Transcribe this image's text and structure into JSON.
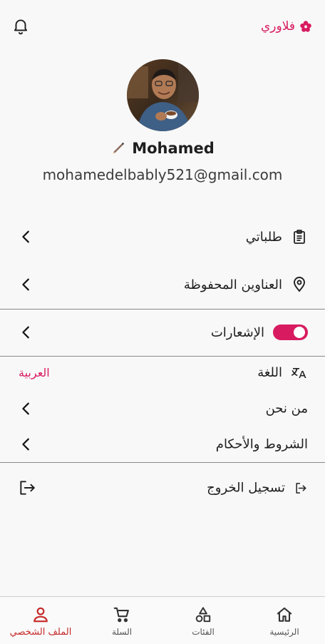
{
  "header": {
    "brand_name": "فلاوري",
    "brand_color": "#d81b60",
    "brand_icon": "flower-icon",
    "notification_icon": "bell-icon"
  },
  "profile": {
    "name": "Mohamed",
    "email": "mohamedelbably521@gmail.com",
    "edit_icon": "pencil-icon",
    "avatar": "profile-photo"
  },
  "menu": {
    "orders": {
      "label": "طلباتي",
      "icon": "clipboard-icon"
    },
    "addresses": {
      "label": "العناوين المحفوظة",
      "icon": "location-pin-icon"
    },
    "notifications": {
      "label": "الإشعارات",
      "enabled": true
    },
    "language": {
      "label": "اللغة",
      "value": "العربية",
      "icon": "translate-icon"
    },
    "about": {
      "label": "من نحن"
    },
    "terms": {
      "label": "الشروط والأحكام"
    },
    "logout": {
      "label": "تسجيل الخروج",
      "icon": "logout-icon"
    }
  },
  "bottom_nav": {
    "items": [
      {
        "label": "الرئيسية",
        "icon": "home-icon",
        "active": false
      },
      {
        "label": "الفئات",
        "icon": "categories-icon",
        "active": false
      },
      {
        "label": "السلة",
        "icon": "cart-icon",
        "active": false
      },
      {
        "label": "الملف الشخصي",
        "icon": "person-icon",
        "active": true
      }
    ],
    "active_color": "#c62828"
  }
}
